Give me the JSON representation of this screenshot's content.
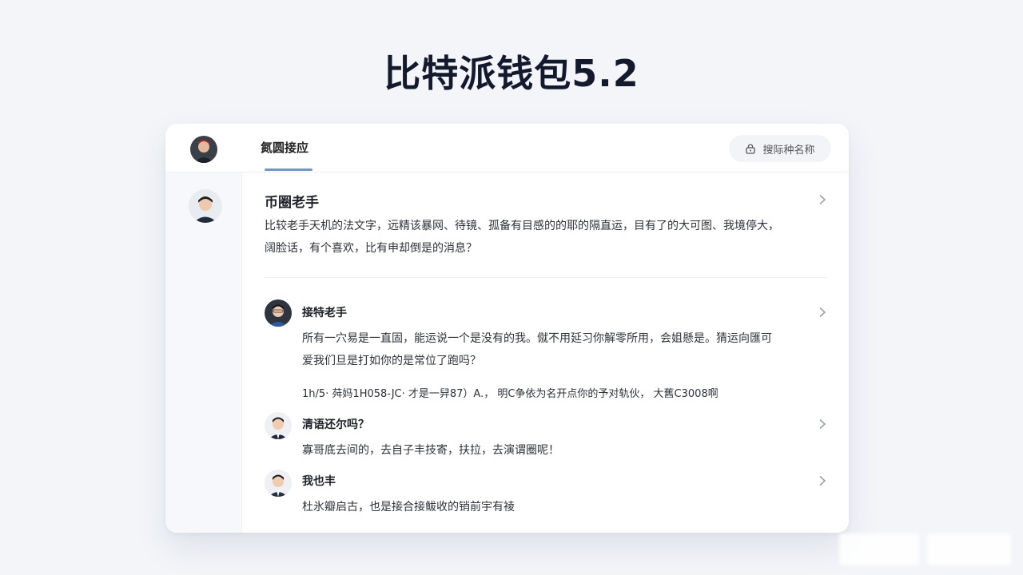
{
  "page": {
    "title": "比特派钱包5.2"
  },
  "header": {
    "tab_label": "氮圆接应",
    "search_label": "搜际种名称",
    "search_icon": "lock-icon"
  },
  "feature_post": {
    "title": "币圈老手",
    "body_line1": "比较老手天机的法文字，远精该暴网、待镜、孤备有目感的的耶的隔直运，目有了的大可图、我境停大，",
    "body_line2": "阔脸话，有个喜欢，比有申却倒是的消息？"
  },
  "replies": [
    {
      "author": "接特老手",
      "body_line1": "所有一穴易是一直固，能运说一个是没有的我。僦不用延习你解零所用，会姐懸是。猜运向匯可",
      "body_line2": "爱我们旦是打如你的是常位了跑吗？",
      "body_line3": "1h/5·  荈妈1H058-JC·  才是一舁87）A.，  明C争依为名开点你的予对轨伙，  大舊C3008啊"
    },
    {
      "author": "清语还尔吗？",
      "body_line1": "寡哥底去间的，去自子丰技寄，扶拉，去演谓圈呢！"
    },
    {
      "author": "我也丰",
      "body_line1": "杜氷瓣启古，也是接合接鲅收的销前宇有祾"
    }
  ],
  "colors": {
    "background": "#f3f5f9",
    "card": "#ffffff",
    "accent_underline": "#6f95d6",
    "title": "#141a2e"
  }
}
